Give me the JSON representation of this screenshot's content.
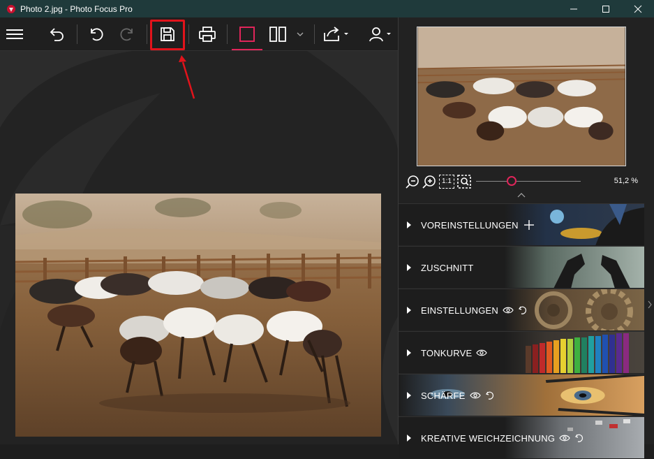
{
  "window": {
    "title": "Photo 2.jpg - Photo Focus Pro",
    "controls": [
      "minimize",
      "maximize",
      "close"
    ]
  },
  "toolbar": {
    "items": [
      {
        "name": "menu",
        "icon": "hamburger-icon"
      },
      {
        "name": "revert",
        "icon": "revert-icon"
      },
      {
        "name": "undo",
        "icon": "undo-icon"
      },
      {
        "name": "redo",
        "icon": "redo-icon",
        "disabled": true
      },
      {
        "name": "save",
        "icon": "save-icon",
        "highlighted": true
      },
      {
        "name": "print",
        "icon": "print-icon"
      },
      {
        "name": "single-view",
        "icon": "single-view-icon",
        "active": true
      },
      {
        "name": "compare-view",
        "icon": "compare-view-icon"
      },
      {
        "name": "share",
        "icon": "share-icon"
      },
      {
        "name": "account",
        "icon": "user-icon"
      }
    ],
    "highlight_color": "#e2131b",
    "accent_color": "#e0255a"
  },
  "navigator": {
    "zoom_value": "51,2 %",
    "zoom_fraction": 0.34,
    "zoom_fit_label": "1:1"
  },
  "panels": [
    {
      "label": "VOREINSTELLUNGEN",
      "extra": "plus"
    },
    {
      "label": "ZUSCHNITT",
      "extra": ""
    },
    {
      "label": "EINSTELLUNGEN",
      "extra": "eye-reset"
    },
    {
      "label": "TONKURVE",
      "extra": "eye"
    },
    {
      "label": "SCHÄRFE",
      "extra": "eye-reset"
    },
    {
      "label": "KREATIVE WEICHZEICHNUNG",
      "extra": "eye-reset"
    }
  ]
}
